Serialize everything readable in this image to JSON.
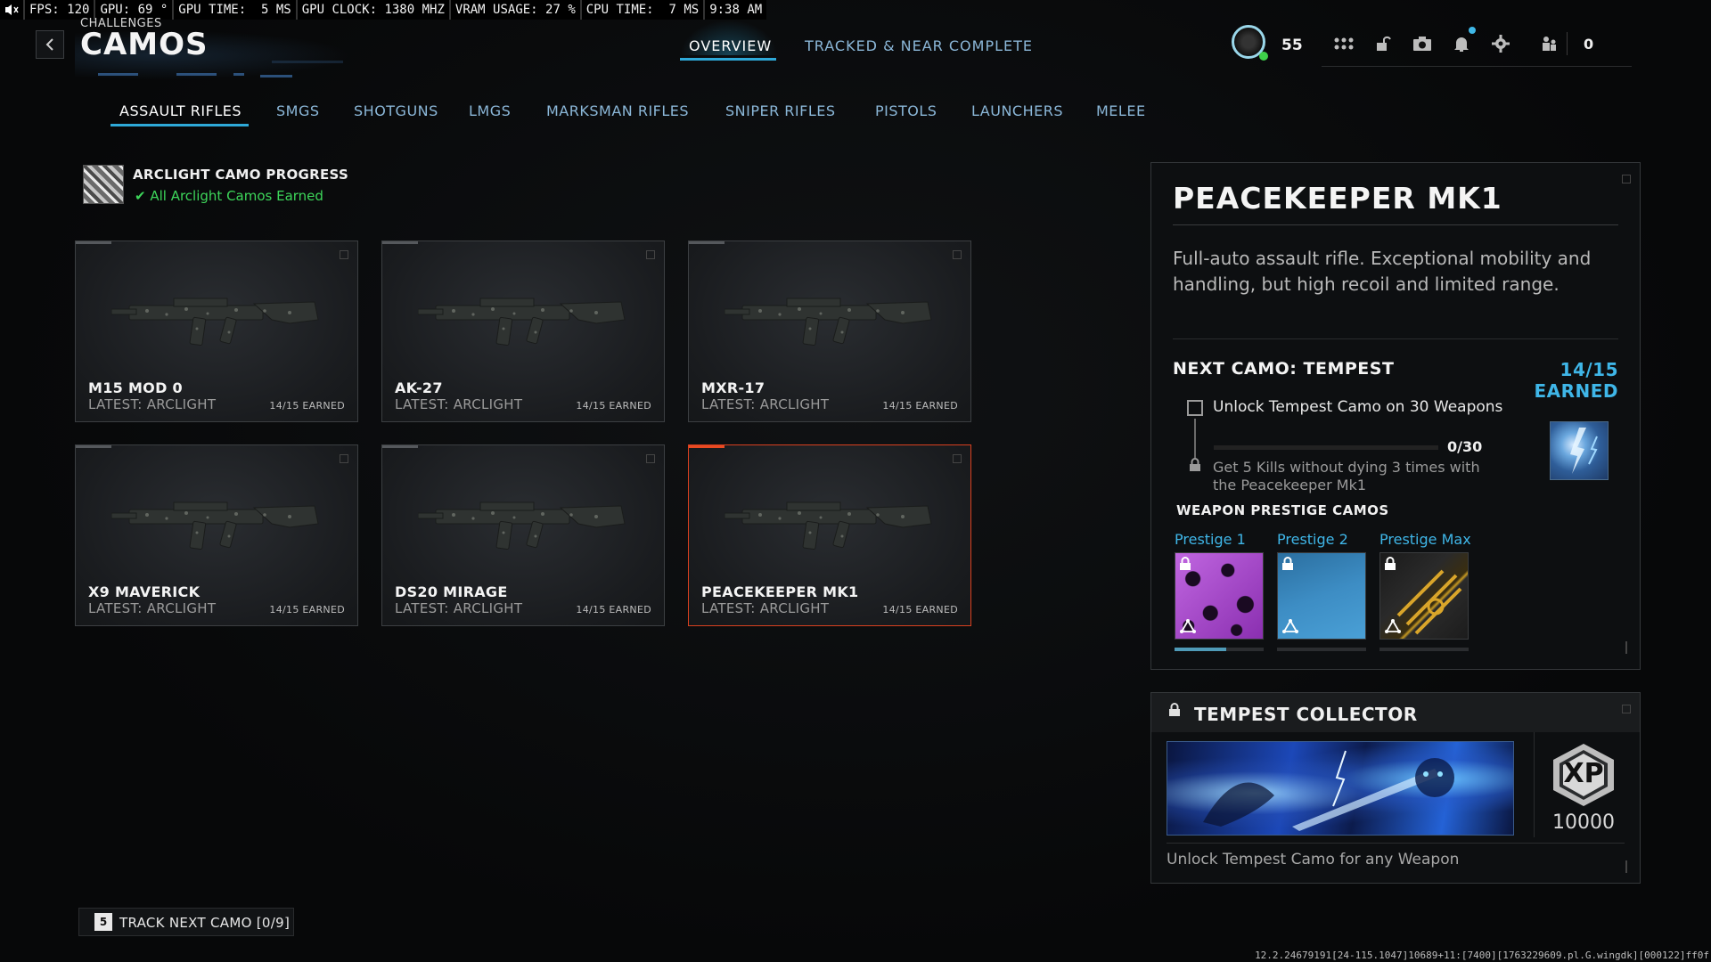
{
  "perf": {
    "fps": "FPS: 120",
    "gpu": "GPU: 69 °",
    "gpu_time": "GPU TIME:  5 MS",
    "gpu_clock": "GPU CLOCK: 1380 MHZ",
    "vram": "VRAM USAGE: 27 %",
    "cpu_time": "CPU TIME:  7 MS",
    "clock": "9:38 AM"
  },
  "header": {
    "breadcrumb": "CHALLENGES",
    "title": "CAMOS",
    "tabs": [
      {
        "label": "OVERVIEW",
        "active": true
      },
      {
        "label": "TRACKED & NEAR COMPLETE",
        "active": false
      }
    ],
    "player_level": "55",
    "friends_online": "0",
    "icons": [
      "grid-icon",
      "unlock-icon",
      "camera-icon",
      "bell-icon",
      "settings-icon",
      "party-icon"
    ]
  },
  "categories": [
    {
      "label": "ASSAULT RIFLES",
      "active": true
    },
    {
      "label": "SMGS"
    },
    {
      "label": "SHOTGUNS"
    },
    {
      "label": "LMGS"
    },
    {
      "label": "MARKSMAN RIFLES"
    },
    {
      "label": "SNIPER RIFLES"
    },
    {
      "label": "PISTOLS"
    },
    {
      "label": "LAUNCHERS"
    },
    {
      "label": "MELEE"
    }
  ],
  "camo_progress": {
    "title": "ARCLIGHT CAMO PROGRESS",
    "status": "All Arclight Camos Earned",
    "status_color": "#3dd65a"
  },
  "weapons": [
    {
      "name": "M15 MOD 0",
      "latest": "LATEST: ARCLIGHT",
      "earned": "14/15 EARNED",
      "selected": false
    },
    {
      "name": "AK-27",
      "latest": "LATEST: ARCLIGHT",
      "earned": "14/15 EARNED",
      "selected": false
    },
    {
      "name": "MXR-17",
      "latest": "LATEST: ARCLIGHT",
      "earned": "14/15 EARNED",
      "selected": false
    },
    {
      "name": "X9 MAVERICK",
      "latest": "LATEST: ARCLIGHT",
      "earned": "14/15 EARNED",
      "selected": false
    },
    {
      "name": "DS20 MIRAGE",
      "latest": "LATEST: ARCLIGHT",
      "earned": "14/15 EARNED",
      "selected": false
    },
    {
      "name": "PEACEKEEPER MK1",
      "latest": "LATEST: ARCLIGHT",
      "earned": "14/15 EARNED",
      "selected": true
    }
  ],
  "detail": {
    "title": "PEACEKEEPER MK1",
    "description": "Full-auto assault rifle. Exceptional mobility and handling, but high recoil and limited range.",
    "next_camo": "NEXT CAMO: TEMPEST",
    "next_earned": "14/15 EARNED",
    "challenge": {
      "label": "Unlock Tempest Camo on 30 Weapons",
      "progress_text": "0/30",
      "progress_fraction": 0,
      "sub_challenge": "Get 5 Kills without dying 3 times with the Peacekeeper Mk1"
    },
    "prestige_heading": "WEAPON PRESTIGE CAMOS",
    "prestige": [
      {
        "label": "Prestige 1",
        "progress_fraction": 0.58
      },
      {
        "label": "Prestige 2",
        "progress_fraction": 0
      },
      {
        "label": "Prestige Max",
        "progress_fraction": 0
      }
    ],
    "accent_color": "#3fb6e8"
  },
  "collector": {
    "title": "TEMPEST COLLECTOR",
    "xp_label": "XP",
    "xp_value": "10000",
    "description": "Unlock Tempest Camo for any Weapon"
  },
  "footer": {
    "track_key": "5",
    "track_label": "TRACK NEXT CAMO [0/9]",
    "build_string": "12.2.24679191[24-115.1047]10689+11:[7400][1763229609.pl.G.wingdk][000122]ff0f"
  }
}
